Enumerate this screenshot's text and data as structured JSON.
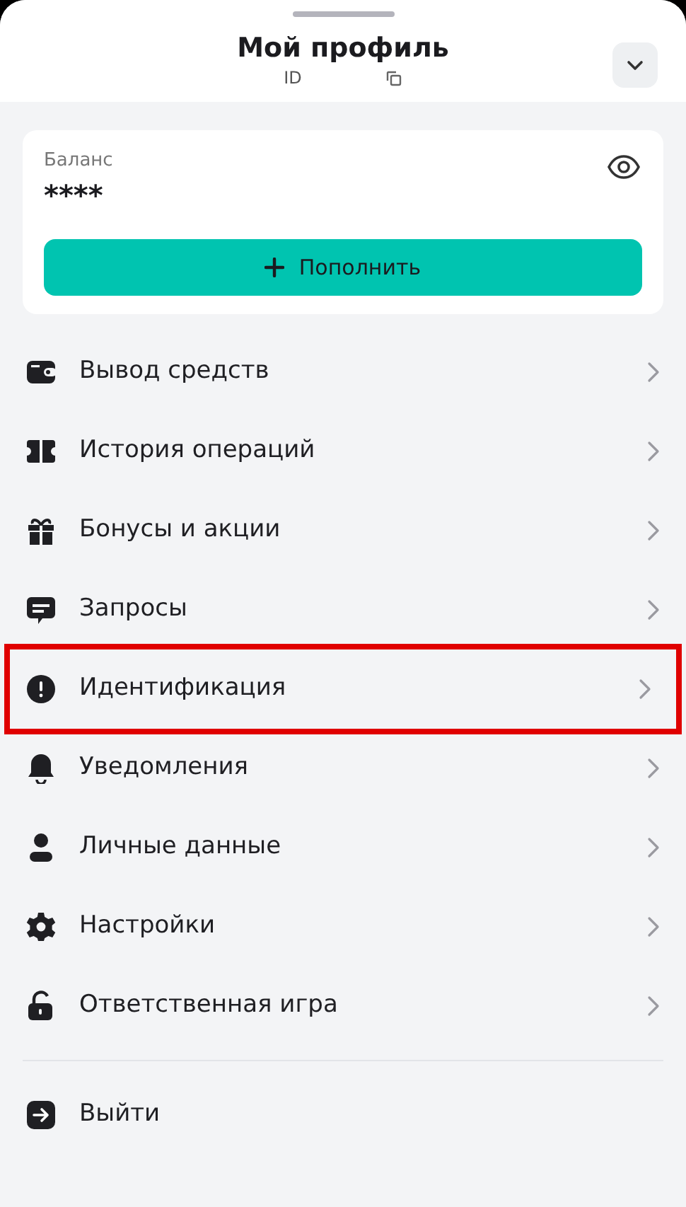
{
  "header": {
    "title": "Мой профиль",
    "id_label": "ID"
  },
  "balance": {
    "label": "Баланс",
    "value": "****",
    "top_up": "Пополнить"
  },
  "menu": [
    {
      "label": "Вывод средств",
      "highlighted": false
    },
    {
      "label": "История операций",
      "highlighted": false
    },
    {
      "label": "Бонусы и акции",
      "highlighted": false
    },
    {
      "label": "Запросы",
      "highlighted": false
    },
    {
      "label": "Идентификация",
      "highlighted": true
    },
    {
      "label": "Уведомления",
      "highlighted": false
    },
    {
      "label": "Личные данные",
      "highlighted": false
    },
    {
      "label": "Настройки",
      "highlighted": false
    },
    {
      "label": "Ответственная игра",
      "highlighted": false
    }
  ],
  "logout": {
    "label": "Выйти"
  }
}
